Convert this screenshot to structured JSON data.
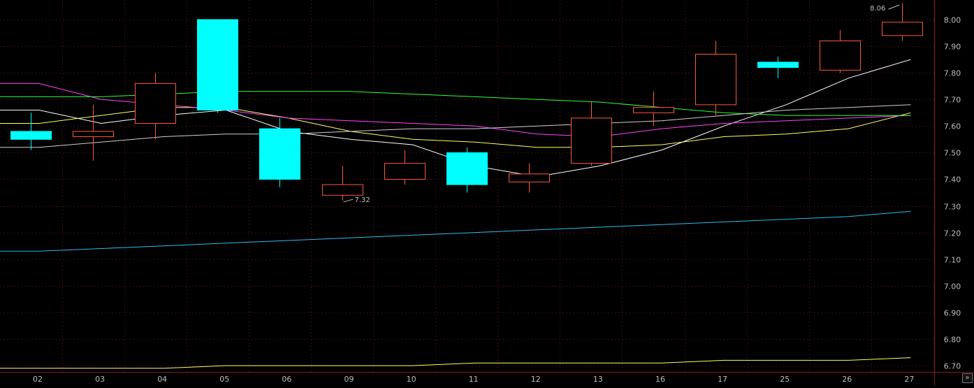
{
  "chart_data": {
    "type": "candlestick",
    "categories": [
      "02",
      "03",
      "04",
      "05",
      "06",
      "09",
      "10",
      "11",
      "12",
      "13",
      "16",
      "17",
      "25",
      "26",
      "27"
    ],
    "ohlc": [
      {
        "open": 7.58,
        "high": 7.65,
        "low": 7.51,
        "close": 7.55
      },
      {
        "open": 7.56,
        "high": 7.68,
        "low": 7.47,
        "close": 7.58
      },
      {
        "open": 7.61,
        "high": 7.8,
        "low": 7.55,
        "close": 7.76
      },
      {
        "open": 8.0,
        "high": 8.0,
        "low": 7.65,
        "close": 7.66
      },
      {
        "open": 7.59,
        "high": 7.63,
        "low": 7.37,
        "close": 7.4
      },
      {
        "open": 7.34,
        "high": 7.45,
        "low": 7.32,
        "close": 7.38
      },
      {
        "open": 7.4,
        "high": 7.51,
        "low": 7.38,
        "close": 7.46
      },
      {
        "open": 7.5,
        "high": 7.52,
        "low": 7.35,
        "close": 7.38
      },
      {
        "open": 7.39,
        "high": 7.46,
        "low": 7.35,
        "close": 7.42
      },
      {
        "open": 7.46,
        "high": 7.69,
        "low": 7.45,
        "close": 7.63
      },
      {
        "open": 7.65,
        "high": 7.73,
        "low": 7.6,
        "close": 7.67
      },
      {
        "open": 7.68,
        "high": 7.92,
        "low": 7.64,
        "close": 7.87
      },
      {
        "open": 7.84,
        "high": 7.86,
        "low": 7.78,
        "close": 7.82
      },
      {
        "open": 7.81,
        "high": 7.96,
        "low": 7.8,
        "close": 7.92
      },
      {
        "open": 7.94,
        "high": 8.06,
        "low": 7.92,
        "close": 7.99
      }
    ],
    "series": [
      {
        "color": "#ffffff",
        "values": [
          7.66,
          7.61,
          7.64,
          7.66,
          7.58,
          7.55,
          7.53,
          7.45,
          7.41,
          7.45,
          7.51,
          7.6,
          7.68,
          7.78,
          7.85
        ]
      },
      {
        "color": "#ffff66",
        "values": [
          7.61,
          7.64,
          7.67,
          7.67,
          7.63,
          7.58,
          7.55,
          7.54,
          7.52,
          7.52,
          7.53,
          7.56,
          7.57,
          7.59,
          7.65
        ]
      },
      {
        "color": "#ff44ff",
        "values": [
          7.76,
          7.7,
          7.68,
          7.66,
          7.63,
          7.62,
          7.61,
          7.6,
          7.57,
          7.56,
          7.59,
          7.61,
          7.62,
          7.63,
          7.64
        ]
      },
      {
        "color": "#33ff33",
        "values": [
          7.71,
          7.71,
          7.72,
          7.73,
          7.73,
          7.73,
          7.72,
          7.71,
          7.7,
          7.69,
          7.67,
          7.65,
          7.64,
          7.64,
          7.64
        ]
      },
      {
        "color": "#cfcfcf",
        "values": [
          7.52,
          7.54,
          7.56,
          7.57,
          7.57,
          7.58,
          7.59,
          7.59,
          7.6,
          7.61,
          7.62,
          7.64,
          7.66,
          7.67,
          7.68
        ]
      },
      {
        "color": "#33bbee",
        "values": [
          7.13,
          7.14,
          7.15,
          7.16,
          7.17,
          7.18,
          7.19,
          7.2,
          7.21,
          7.22,
          7.23,
          7.24,
          7.25,
          7.26,
          7.28
        ]
      },
      {
        "color": "#ffff66",
        "values": [
          6.69,
          6.69,
          6.69,
          6.7,
          6.7,
          6.7,
          6.7,
          6.71,
          6.71,
          6.71,
          6.71,
          6.72,
          6.72,
          6.72,
          6.73
        ]
      }
    ],
    "yticks": [
      "8.00",
      "7.90",
      "7.80",
      "7.70",
      "7.60",
      "7.50",
      "7.40",
      "7.30",
      "7.20",
      "7.10",
      "7.00",
      "6.90",
      "6.80",
      "6.70"
    ],
    "ylim": [
      6.7,
      8.0
    ],
    "annotations": [
      {
        "text": "8.06",
        "x": "27",
        "y": 8.06
      },
      {
        "text": "7.32",
        "x": "09",
        "y": 7.32
      }
    ],
    "colors": {
      "up": "#ff5a3c",
      "down": "#00ffff",
      "grid": "#3a0e0e",
      "axis_text": "#bdbdbd"
    },
    "grid": true
  },
  "ui": {
    "scroll_right_label": "»"
  }
}
